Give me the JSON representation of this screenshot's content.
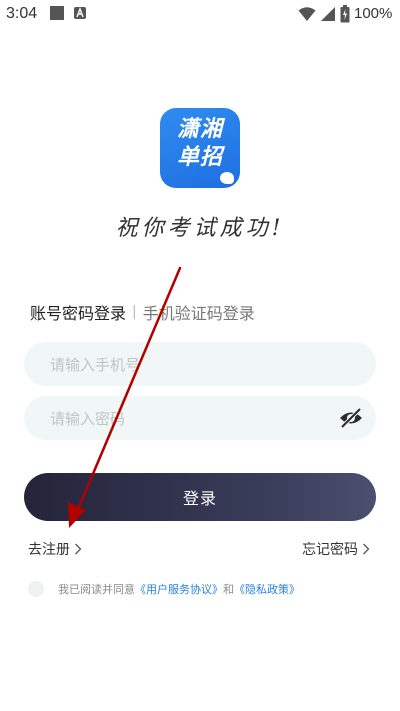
{
  "status_bar": {
    "time": "3:04",
    "battery_percent": "100%"
  },
  "logo": {
    "line1": "潇湘",
    "line2": "单招"
  },
  "slogan": "祝你考试成功!",
  "tabs": {
    "account_login": "账号密码登录",
    "separator": "|",
    "sms_login": "手机验证码登录"
  },
  "phone_field": {
    "placeholder": "请输入手机号",
    "value": ""
  },
  "password_field": {
    "placeholder": "请输入密码",
    "value": ""
  },
  "login_button": "登录",
  "register_link": "去注册",
  "forgot_link": "忘记密码",
  "agreement": {
    "prefix": "我已阅读并同意",
    "user_agreement": "《用户服务协议》",
    "and": "和",
    "privacy_policy": "《隐私政策》"
  },
  "colors": {
    "accent_link": "#2a82e4",
    "logo_blue": "#2f8cf0",
    "button_dark": "#24243a",
    "annotation_arrow": "#b00000"
  },
  "icons": [
    "wifi-icon",
    "signal-icon",
    "battery-icon",
    "eye-off-icon",
    "chevron-right-icon"
  ]
}
